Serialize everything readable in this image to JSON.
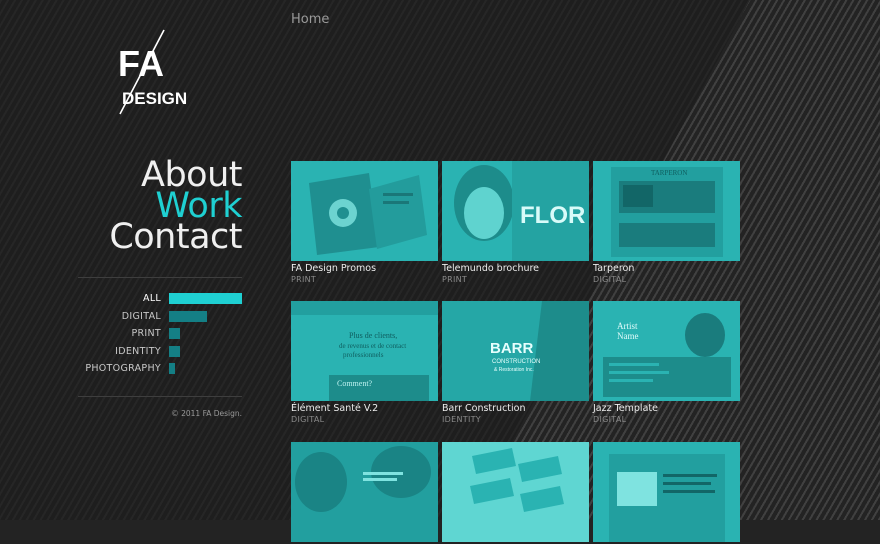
{
  "breadcrumb": "Home",
  "logo": {
    "text_top": "FA",
    "text_bottom": "DESIGN"
  },
  "nav": [
    {
      "label": "About",
      "active": false
    },
    {
      "label": "Work",
      "active": true
    },
    {
      "label": "Contact",
      "active": false
    }
  ],
  "filters": [
    {
      "label": "ALL",
      "active": true,
      "level": 1.0
    },
    {
      "label": "DIGITAL",
      "active": false,
      "level": 0.52
    },
    {
      "label": "PRINT",
      "active": false,
      "level": 0.15
    },
    {
      "label": "IDENTITY",
      "active": false,
      "level": 0.15
    },
    {
      "label": "PHOTOGRAPHY",
      "active": false,
      "level": 0.08
    }
  ],
  "copyright": "© 2011 FA Design.",
  "projects": [
    {
      "title": "FA Design Promos",
      "category": "PRINT"
    },
    {
      "title": "Telemundo brochure",
      "category": "PRINT"
    },
    {
      "title": "Tarperon",
      "category": "DIGITAL"
    },
    {
      "title": "Élément Santé V.2",
      "category": "DIGITAL"
    },
    {
      "title": "Barr Construction",
      "category": "IDENTITY"
    },
    {
      "title": "Jazz Template",
      "category": "DIGITAL"
    },
    {
      "title": "",
      "category": ""
    },
    {
      "title": "",
      "category": ""
    },
    {
      "title": "",
      "category": ""
    }
  ],
  "thumb_text": {
    "flor": "FLOR",
    "tarperon": "TARPERON",
    "element_plus": "Plus de clients,",
    "element_line2": "de revenus et de contact",
    "element_line3": "professionnels",
    "element_comment": "Comment?",
    "barr": "BARR",
    "barr_sub": "CONSTRUCTION",
    "barr_sub2": "& Restoration Inc.",
    "jazz_artist": "Artist",
    "jazz_name": "Name"
  },
  "colors": {
    "accent": "#1fd0d2",
    "bar_inactive": "#147f85",
    "thumb_tint": "#2ab3b2"
  }
}
